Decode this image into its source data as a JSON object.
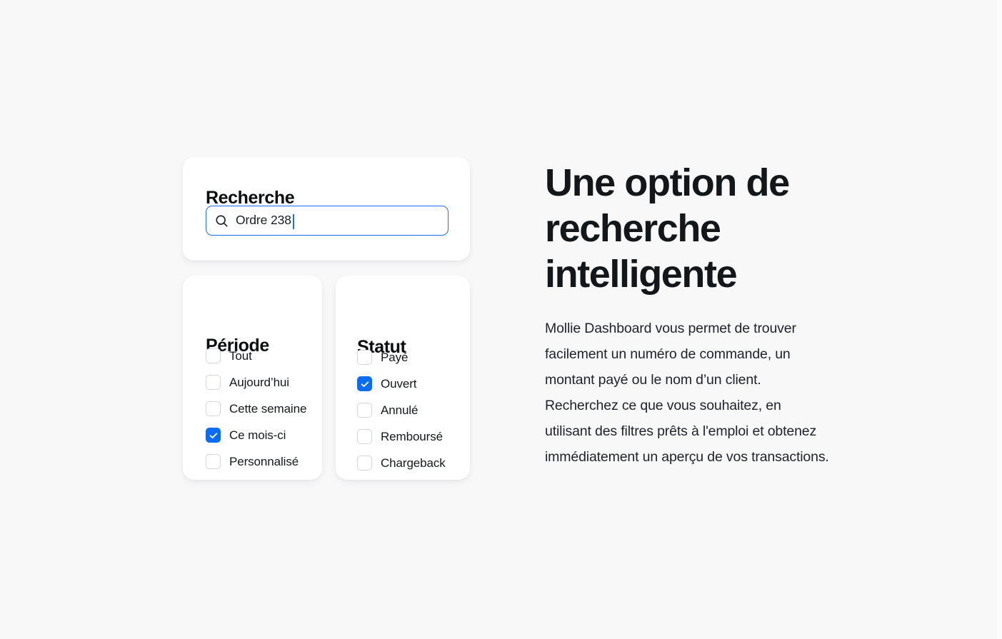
{
  "theme": {
    "background": "#f8f8f9",
    "card_background": "#ffffff",
    "accent_blue": "#0a6cf0",
    "focus_blue": "#1b6ef3",
    "text_dark": "#14171a",
    "checkbox_border": "#d2d6da"
  },
  "search_card": {
    "title": "Recherche",
    "input": {
      "value": "Ordre 238",
      "placeholder": "Recherche",
      "icon": "search-icon",
      "focused": true,
      "caret_visible": true
    }
  },
  "period_card": {
    "title": "Période",
    "options": [
      {
        "label": "Tout",
        "checked": false
      },
      {
        "label": "Aujourd’hui",
        "checked": false
      },
      {
        "label": "Cette semaine",
        "checked": false
      },
      {
        "label": "Ce mois-ci",
        "checked": true
      },
      {
        "label": "Personnalisé",
        "checked": false
      }
    ]
  },
  "status_card": {
    "title": "Statut",
    "options": [
      {
        "label": "Payé",
        "checked": false
      },
      {
        "label": "Ouvert",
        "checked": true
      },
      {
        "label": "Annulé",
        "checked": false
      },
      {
        "label": "Remboursé",
        "checked": false
      },
      {
        "label": "Chargeback",
        "checked": false
      }
    ]
  },
  "copy": {
    "headline": "Une option de recherche intelligente",
    "body": "Mollie Dashboard vous permet de trouver facilement un numéro de commande, un montant payé ou le nom d’un client. Recherchez ce que vous souhaitez, en utilisant des filtres prêts à l'emploi et obtenez immédiatement un aperçu de vos transactions."
  }
}
